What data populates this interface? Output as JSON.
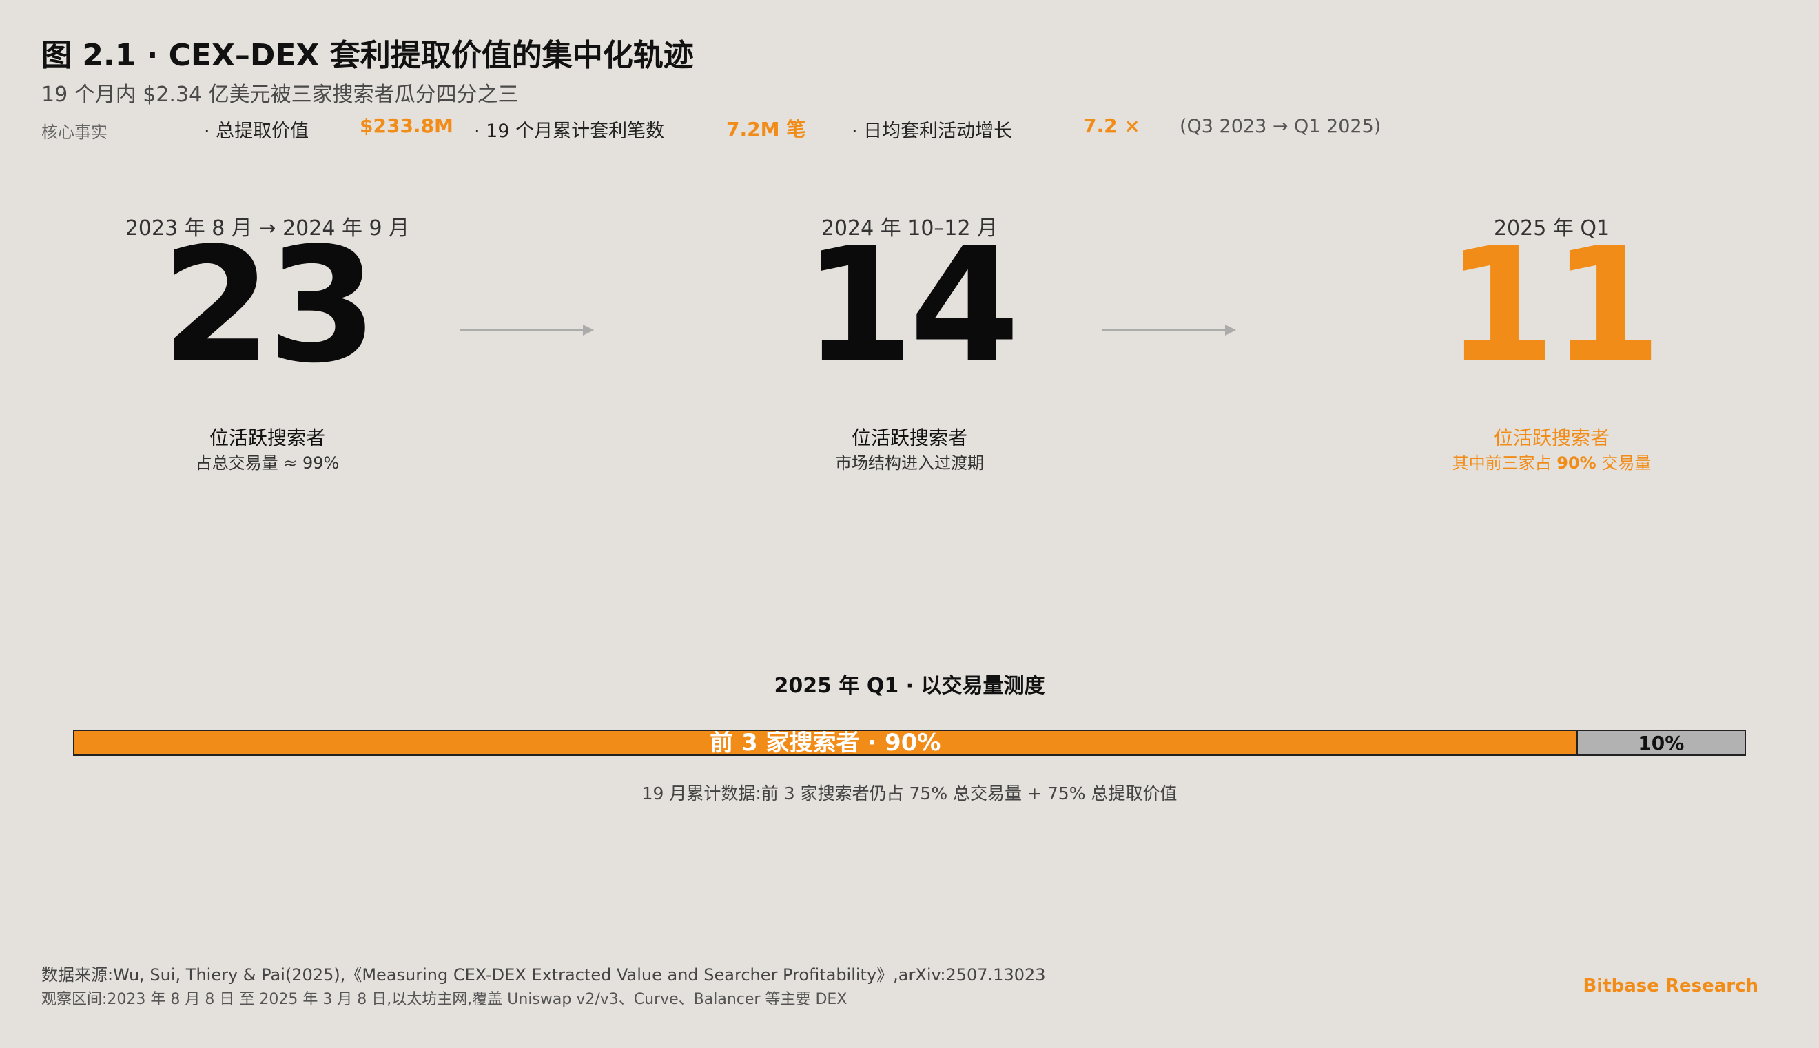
{
  "header": {
    "title": "图 2.1 · CEX–DEX 套利提取价值的集中化轨迹",
    "subtitle": "19 个月内 $2.34 亿美元被三家搜索者瓜分四分之三"
  },
  "facts": {
    "label": "核心事实",
    "items": [
      {
        "name": "· 总提取价值",
        "value": "$233.8M"
      },
      {
        "name": "· 19 个月累计套利笔数",
        "value": "7.2M 笔"
      },
      {
        "name": "· 日均套利活动增长",
        "value": "7.2 ×"
      }
    ],
    "note": "(Q3 2023 → Q1 2025)"
  },
  "stages": [
    {
      "period": "2023 年 8 月 → 2024 年 9 月",
      "count": "23",
      "label": "位活跃搜索者",
      "sub": "占总交易量 ≈ 99%"
    },
    {
      "period": "2024 年 10–12 月",
      "count": "14",
      "label": "位活跃搜索者",
      "sub": "市场结构进入过渡期"
    },
    {
      "period": "2025 年 Q1",
      "count": "11",
      "label": "位活跃搜索者",
      "sub_pre": "其中前三家占 ",
      "sub_bold": "90%",
      "sub_post": " 交易量"
    }
  ],
  "measure": {
    "title": "2025 年 Q1 · 以交易量测度",
    "top_label": "前 3 家搜索者 · 90%",
    "top_share": 90,
    "rest_label": "10%",
    "rest_share": 10,
    "note": "19 月累计数据:前 3 家搜索者仍占 75% 总交易量 + 75% 总提取价值"
  },
  "colors": {
    "accent": "#f28c18",
    "background": "#e4e0db",
    "rest": "#b2b2b2"
  },
  "footer": {
    "source": "数据来源:Wu, Sui, Thiery & Pai(2025),《Measuring CEX-DEX Extracted Value and Searcher Profitability》,arXiv:2507.13023",
    "window": "观察区间:2023 年 8 月 8 日 至 2025 年 3 月 8 日,以太坊主网,覆盖 Uniswap v2/v3、Curve、Balancer 等主要 DEX",
    "brand": "Bitbase Research"
  }
}
